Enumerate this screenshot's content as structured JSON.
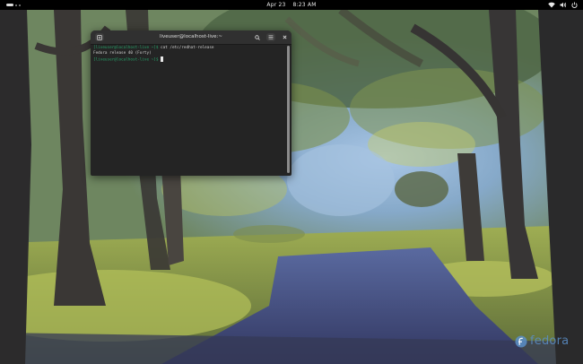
{
  "topbar": {
    "date": "Apr 23",
    "time": "8:23 AM",
    "status_icons": [
      "wifi-icon",
      "volume-icon",
      "power-icon"
    ]
  },
  "terminal": {
    "title": "liveuser@localhost-live:~",
    "lines": [
      {
        "prompt": "[liveuser@localhost-live ~]$",
        "command": " cat /etc/redhat-release"
      },
      {
        "output": "Fedora release 40 (Forty)"
      },
      {
        "prompt": "[liveuser@localhost-live ~]$",
        "command": " "
      }
    ],
    "header_icons": [
      "new-tab-icon",
      "search-icon",
      "menu-icon",
      "close-icon"
    ]
  },
  "wallpaper": {
    "brand": "fedora",
    "colors": {
      "sky": "#8fb4d6",
      "path": "#3e4570",
      "foliage": "#9aa84a",
      "trunk": "#2b2a2a"
    }
  }
}
